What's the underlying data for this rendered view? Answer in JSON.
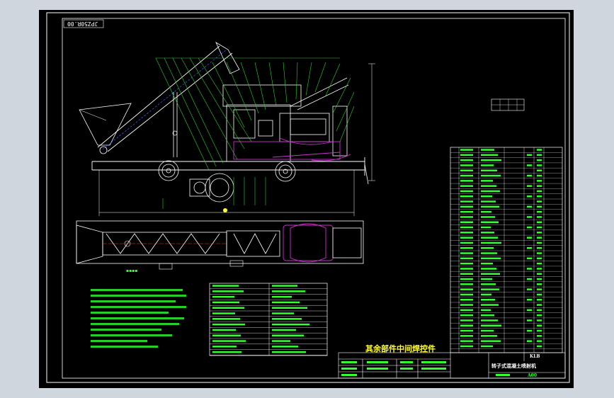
{
  "drawing": {
    "code_label": "JPZ50R.00",
    "parts_note": "其余部件中间焊控件",
    "title_block_name": "转子式混凝土喷射机",
    "ref_label": "KLB",
    "small_label": "A00"
  },
  "colors": {
    "background": "#cfd6de",
    "paper": "#000000",
    "frame": "#ffffff",
    "leader": "#33cc33",
    "text_green": "#33ff33",
    "accent": "#ffff33",
    "purple": "#cc33cc",
    "red": "#ff3333"
  }
}
